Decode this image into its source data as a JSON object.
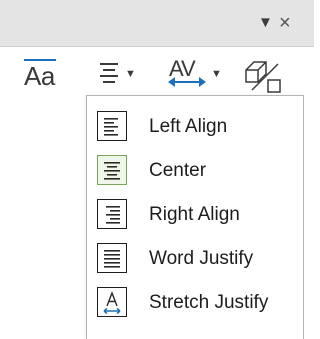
{
  "window": {
    "menu_icon": "dropdown-triangle-icon",
    "close_glyph": "×"
  },
  "toolbar": {
    "character_label": "Aa",
    "spacing_label": "AV",
    "icons": [
      "character-icon",
      "align-icon",
      "character-spacing-icon",
      "fontwork-shape-icon"
    ]
  },
  "align_menu": {
    "items": [
      {
        "label": "Left Align",
        "icon": "align-left-icon",
        "selected": false
      },
      {
        "label": "Center",
        "icon": "align-center-icon",
        "selected": true
      },
      {
        "label": "Right Align",
        "icon": "align-right-icon",
        "selected": false
      },
      {
        "label": "Word Justify",
        "icon": "word-justify-icon",
        "selected": false
      },
      {
        "label": "Stretch Justify",
        "icon": "stretch-justify-icon",
        "selected": false
      }
    ]
  },
  "colors": {
    "accent": "#1e6fb9",
    "selected_border": "#7aa45a",
    "selected_fill": "#eef6ea"
  }
}
